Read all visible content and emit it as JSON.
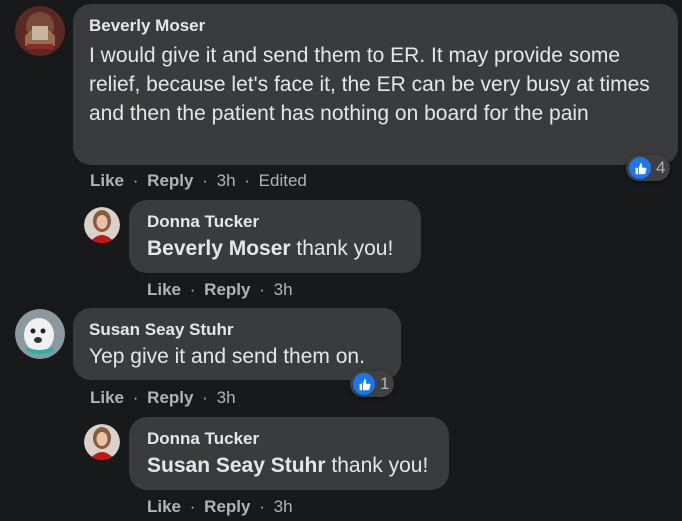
{
  "comments": [
    {
      "author": "Beverly Moser",
      "text": "I would give it and send them to ER. It may provide some relief, because let's face it, the ER can be very busy at times and then the patient has nothing on board for the pain",
      "like_label": "Like",
      "reply_label": "Reply",
      "time": "3h",
      "edited": "Edited",
      "reaction_count": "4"
    },
    {
      "author": "Donna Tucker",
      "mention": "Beverly Moser",
      "text": " thank you!",
      "like_label": "Like",
      "reply_label": "Reply",
      "time": "3h"
    },
    {
      "author": "Susan Seay Stuhr",
      "text": "Yep give it and send them on.",
      "like_label": "Like",
      "reply_label": "Reply",
      "time": "3h",
      "reaction_count": "1"
    },
    {
      "author": "Donna Tucker",
      "mention": "Susan Seay Stuhr",
      "text": " thank you!",
      "like_label": "Like",
      "reply_label": "Reply",
      "time": "3h"
    }
  ],
  "separator": "·",
  "colors": {
    "background": "#18191a",
    "bubble": "#3a3b3c",
    "like_blue": "#1877f2",
    "muted_text": "#b0b3b8"
  }
}
